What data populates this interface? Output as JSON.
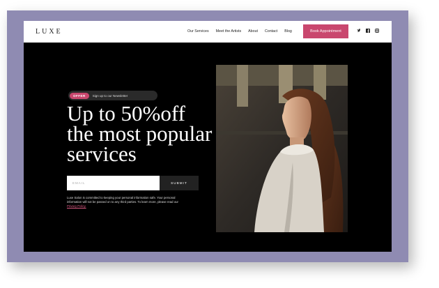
{
  "brand": {
    "logo": "LUXE"
  },
  "nav": {
    "links": [
      "Our Services",
      "Meet the Artists",
      "About",
      "Contact",
      "Blog"
    ],
    "cta": "Book Appointment",
    "social": [
      "twitter-icon",
      "facebook-icon",
      "instagram-icon"
    ]
  },
  "hero": {
    "badge": {
      "tag": "OFFER",
      "text": "Sign up to our Newsletter"
    },
    "headline": [
      "Up to 50%off",
      "the most popular",
      "services"
    ],
    "form": {
      "email_placeholder": "EMAIL",
      "submit_label": "SUBMIT"
    },
    "disclaimer": "Luxe Salon is committed to keeping your personal information safe. Your personal information will not be passed on to any third parties. To learn more, please read our",
    "privacy_link": "Privacy Policy.",
    "image_alt": "woman-portrait"
  },
  "colors": {
    "accent": "#c9476e",
    "frame": "#8f8bb2",
    "background": "#000000"
  }
}
